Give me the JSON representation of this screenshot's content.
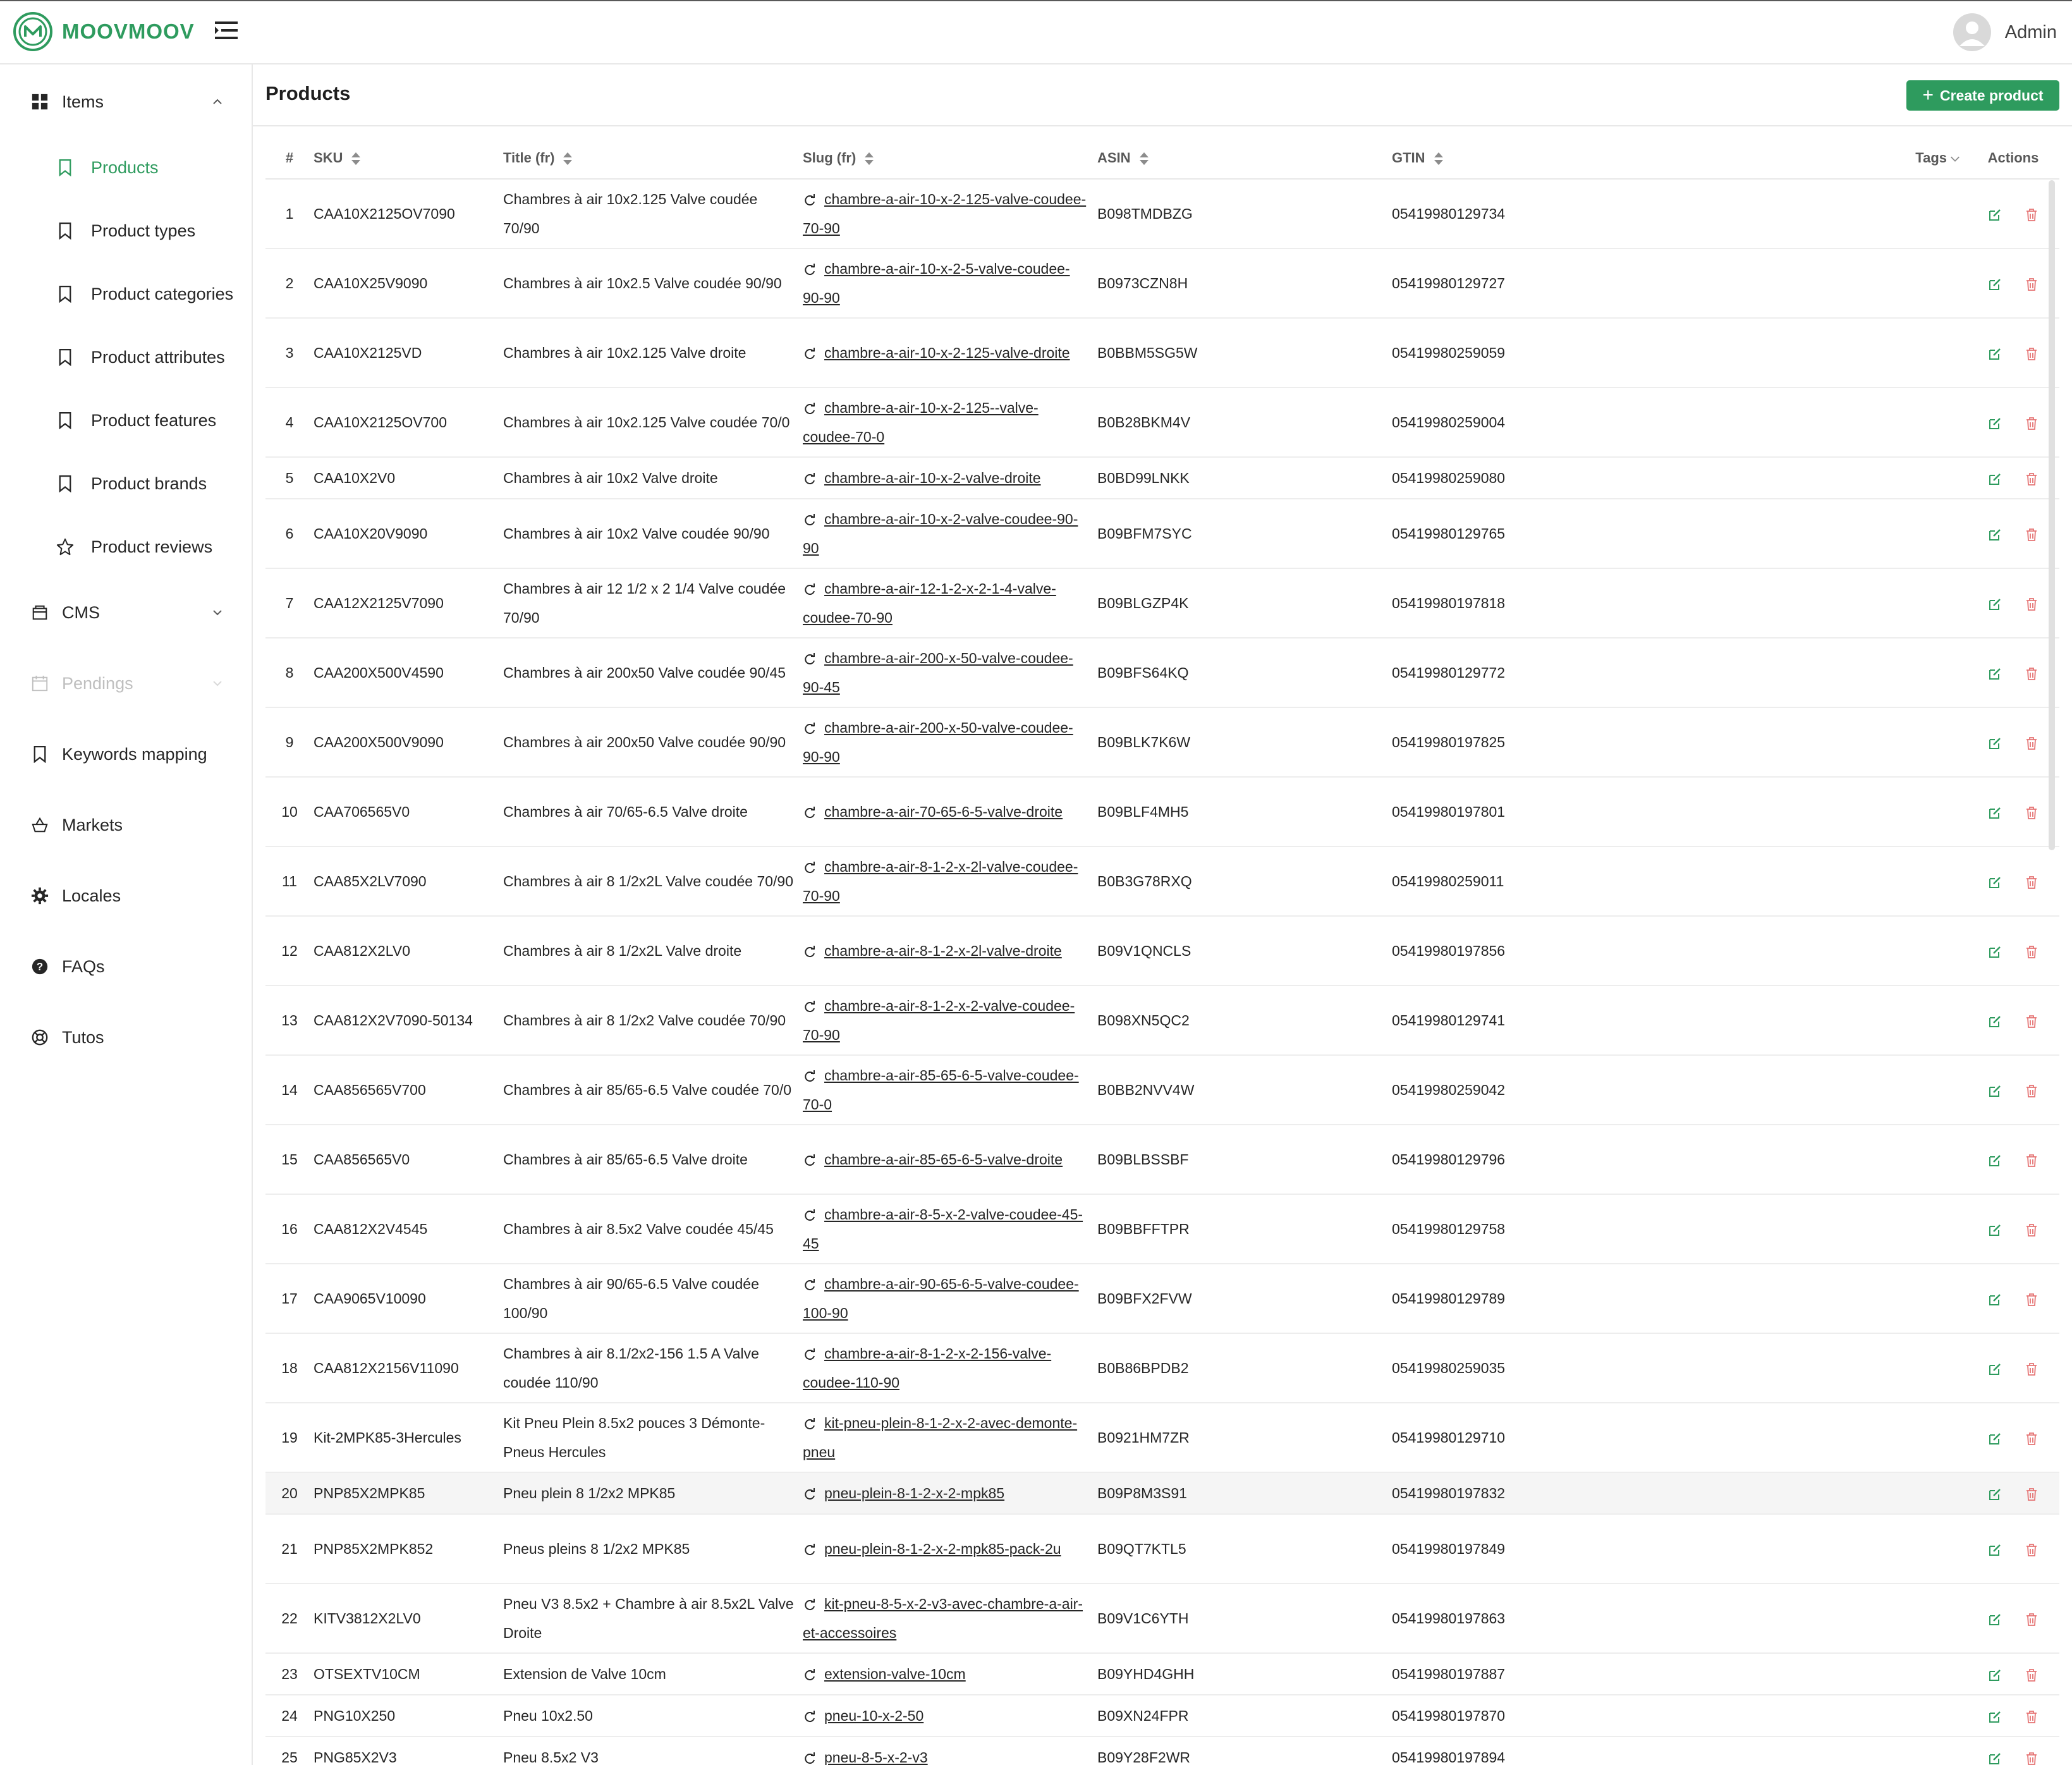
{
  "brand": {
    "name": "MOOVMOOV",
    "color": "#2e9b5e"
  },
  "header": {
    "user_name": "Admin"
  },
  "sidebar": {
    "items_group": "Items",
    "sub_items": [
      {
        "label": "Products",
        "active": true
      },
      {
        "label": "Product types"
      },
      {
        "label": "Product categories"
      },
      {
        "label": "Product attributes"
      },
      {
        "label": "Product features"
      },
      {
        "label": "Product brands"
      },
      {
        "label": "Product reviews"
      }
    ],
    "cms": "CMS",
    "pendings": "Pendings",
    "keywords_mapping": "Keywords mapping",
    "markets": "Markets",
    "locales": "Locales",
    "faqs": "FAQs",
    "tutos": "Tutos"
  },
  "page": {
    "title": "Products",
    "create_label": "Create product"
  },
  "table": {
    "columns": [
      "#",
      "SKU",
      "Title (fr)",
      "Slug (fr)",
      "ASIN",
      "GTIN",
      "Tags",
      "Actions"
    ],
    "rows": [
      {
        "n": "1",
        "sku": "CAA10X2125OV7090",
        "title": "Chambres à air 10x2.125 Valve coudée 70/90",
        "slug": "chambre-a-air-10-x-2-125-valve-coudee-70-90",
        "asin": "B098TMDBZG",
        "gtin": "05419980129734"
      },
      {
        "n": "2",
        "sku": "CAA10X25V9090",
        "title": "Chambres à air 10x2.5 Valve coudée 90/90",
        "slug": "chambre-a-air-10-x-2-5-valve-coudee-90-90",
        "asin": "B0973CZN8H",
        "gtin": "05419980129727"
      },
      {
        "n": "3",
        "sku": "CAA10X2125VD",
        "title": "Chambres à air 10x2.125 Valve droite",
        "slug": "chambre-a-air-10-x-2-125-valve-droite",
        "asin": "B0BBM5SG5W",
        "gtin": "05419980259059"
      },
      {
        "n": "4",
        "sku": "CAA10X2125OV700",
        "title": "Chambres à air 10x2.125 Valve coudée 70/0",
        "slug": "chambre-a-air-10-x-2-125--valve-coudee-70-0",
        "asin": "B0B28BKM4V",
        "gtin": "05419980259004"
      },
      {
        "n": "5",
        "sku": "CAA10X2V0",
        "title": "Chambres à air 10x2 Valve droite",
        "slug": "chambre-a-air-10-x-2-valve-droite",
        "asin": "B0BD99LNKK",
        "gtin": "05419980259080"
      },
      {
        "n": "6",
        "sku": "CAA10X20V9090",
        "title": "Chambres à air 10x2 Valve coudée 90/90",
        "slug": "chambre-a-air-10-x-2-valve-coudee-90-90",
        "asin": "B09BFM7SYC",
        "gtin": "05419980129765"
      },
      {
        "n": "7",
        "sku": "CAA12X2125V7090",
        "title": "Chambres à air 12 1/2 x 2 1/4 Valve coudée 70/90",
        "slug": "chambre-a-air-12-1-2-x-2-1-4-valve-coudee-70-90",
        "asin": "B09BLGZP4K",
        "gtin": "05419980197818"
      },
      {
        "n": "8",
        "sku": "CAA200X500V4590",
        "title": "Chambres à air 200x50 Valve coudée 90/45",
        "slug": "chambre-a-air-200-x-50-valve-coudee-90-45",
        "asin": "B09BFS64KQ",
        "gtin": "05419980129772"
      },
      {
        "n": "9",
        "sku": "CAA200X500V9090",
        "title": "Chambres à air 200x50 Valve coudée 90/90",
        "slug": "chambre-a-air-200-x-50-valve-coudee-90-90",
        "asin": "B09BLK7K6W",
        "gtin": "05419980197825"
      },
      {
        "n": "10",
        "sku": "CAA706565V0",
        "title": "Chambres à air 70/65-6.5 Valve droite",
        "slug": "chambre-a-air-70-65-6-5-valve-droite",
        "asin": "B09BLF4MH5",
        "gtin": "05419980197801"
      },
      {
        "n": "11",
        "sku": "CAA85X2LV7090",
        "title": "Chambres à air 8 1/2x2L Valve coudée 70/90",
        "slug": "chambre-a-air-8-1-2-x-2l-valve-coudee-70-90",
        "asin": "B0B3G78RXQ",
        "gtin": "05419980259011"
      },
      {
        "n": "12",
        "sku": "CAA812X2LV0",
        "title": "Chambres à air 8 1/2x2L Valve droite",
        "slug": "chambre-a-air-8-1-2-x-2l-valve-droite",
        "asin": "B09V1QNCLS",
        "gtin": "05419980197856"
      },
      {
        "n": "13",
        "sku": "CAA812X2V7090-50134",
        "title": "Chambres à air 8 1/2x2 Valve coudée 70/90",
        "slug": "chambre-a-air-8-1-2-x-2-valve-coudee-70-90",
        "asin": "B098XN5QC2",
        "gtin": "05419980129741"
      },
      {
        "n": "14",
        "sku": "CAA856565V700",
        "title": "Chambres à air 85/65-6.5 Valve coudée 70/0",
        "slug": "chambre-a-air-85-65-6-5-valve-coudee-70-0",
        "asin": "B0BB2NVV4W",
        "gtin": "05419980259042"
      },
      {
        "n": "15",
        "sku": "CAA856565V0",
        "title": "Chambres à air 85/65-6.5 Valve droite",
        "slug": "chambre-a-air-85-65-6-5-valve-droite",
        "asin": "B09BLBSSBF",
        "gtin": "05419980129796"
      },
      {
        "n": "16",
        "sku": "CAA812X2V4545",
        "title": "Chambres à air 8.5x2 Valve coudée 45/45",
        "slug": "chambre-a-air-8-5-x-2-valve-coudee-45-45",
        "asin": "B09BBFFTPR",
        "gtin": "05419980129758"
      },
      {
        "n": "17",
        "sku": "CAA9065V10090",
        "title": "Chambres à air 90/65-6.5 Valve coudée 100/90",
        "slug": "chambre-a-air-90-65-6-5-valve-coudee-100-90",
        "asin": "B09BFX2FVW",
        "gtin": "05419980129789"
      },
      {
        "n": "18",
        "sku": "CAA812X2156V11090",
        "title": "Chambres à air 8.1/2x2-156 1.5 A Valve coudée 110/90",
        "slug": "chambre-a-air-8-1-2-x-2-156-valve-coudee-110-90",
        "asin": "B0B86BPDB2",
        "gtin": "05419980259035"
      },
      {
        "n": "19",
        "sku": "Kit-2MPK85-3Hercules",
        "title": "Kit Pneu Plein 8.5x2 pouces 3 Démonte-Pneus Hercules",
        "slug": "kit-pneu-plein-8-1-2-x-2-avec-demonte-pneu",
        "asin": "B0921HM7ZR",
        "gtin": "05419980129710"
      },
      {
        "n": "20",
        "sku": "PNP85X2MPK85",
        "title": "Pneu plein 8 1/2x2 MPK85",
        "slug": "pneu-plein-8-1-2-x-2-mpk85",
        "asin": "B09P8M3S91",
        "gtin": "05419980197832"
      },
      {
        "n": "21",
        "sku": "PNP85X2MPK852",
        "title": "Pneus pleins 8 1/2x2 MPK85",
        "slug": "pneu-plein-8-1-2-x-2-mpk85-pack-2u",
        "asin": "B09QT7KTL5",
        "gtin": "05419980197849"
      },
      {
        "n": "22",
        "sku": "KITV3812X2LV0",
        "title": "Pneu V3 8.5x2 + Chambre à air 8.5x2L Valve Droite",
        "slug": "kit-pneu-8-5-x-2-v3-avec-chambre-a-air-et-accessoires",
        "asin": "B09V1C6YTH",
        "gtin": "05419980197863"
      },
      {
        "n": "23",
        "sku": "OTSEXTV10CM",
        "title": "Extension de Valve 10cm",
        "slug": "extension-valve-10cm",
        "asin": "B09YHD4GHH",
        "gtin": "05419980197887"
      },
      {
        "n": "24",
        "sku": "PNG10X250",
        "title": "Pneu 10x2.50",
        "slug": "pneu-10-x-2-50",
        "asin": "B09XN24FPR",
        "gtin": "05419980197870"
      },
      {
        "n": "25",
        "sku": "PNG85X2V3",
        "title": "Pneu 8.5x2 V3",
        "slug": "pneu-8-5-x-2-v3",
        "asin": "B09Y28F2WR",
        "gtin": "05419980197894"
      }
    ]
  },
  "colors": {
    "accent": "#2e9b5e",
    "delete": "#e57373",
    "edit": "#2e9b5e"
  }
}
